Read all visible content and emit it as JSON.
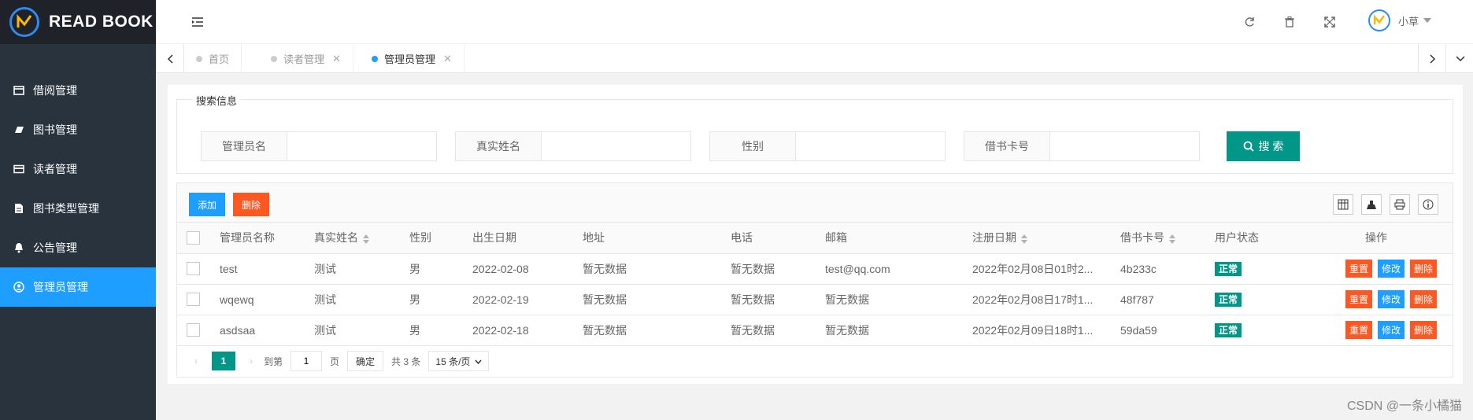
{
  "app": {
    "logo_text": "READ BOOK"
  },
  "sidebar": {
    "items": [
      {
        "label": "借阅管理",
        "icon": "window-icon"
      },
      {
        "label": "图书管理",
        "icon": "book-icon"
      },
      {
        "label": "读者管理",
        "icon": "card-icon"
      },
      {
        "label": "图书类型管理",
        "icon": "file-icon"
      },
      {
        "label": "公告管理",
        "icon": "bell-icon"
      },
      {
        "label": "管理员管理",
        "icon": "user-circle-icon",
        "active": true
      }
    ]
  },
  "header": {
    "user_name": "小草"
  },
  "tabs": [
    {
      "label": "首页"
    },
    {
      "label": "读者管理"
    },
    {
      "label": "管理员管理",
      "active": true
    }
  ],
  "search": {
    "legend": "搜索信息",
    "fields": [
      {
        "label": "管理员名",
        "value": ""
      },
      {
        "label": "真实姓名",
        "value": ""
      },
      {
        "label": "性别",
        "value": ""
      },
      {
        "label": "借书卡号",
        "value": ""
      }
    ],
    "button": "搜 索"
  },
  "toolbar": {
    "add": "添加",
    "delete": "删除"
  },
  "table": {
    "headers": [
      "管理员名称",
      "真实姓名",
      "性别",
      "出生日期",
      "地址",
      "电话",
      "邮箱",
      "注册日期",
      "借书卡号",
      "用户状态",
      "操作"
    ],
    "rows": [
      {
        "name": "test",
        "real": "测试",
        "sex": "男",
        "birth": "2022-02-08",
        "addr": "暂无数据",
        "phone": "暂无数据",
        "email": "test@qq.com",
        "reg": "2022年02月08日01时2...",
        "card": "4b233c",
        "status": "正常"
      },
      {
        "name": "wqewq",
        "real": "测试",
        "sex": "男",
        "birth": "2022-02-19",
        "addr": "暂无数据",
        "phone": "暂无数据",
        "email": "暂无数据",
        "reg": "2022年02月08日17时1...",
        "card": "48f787",
        "status": "正常"
      },
      {
        "name": "asdsaa",
        "real": "测试",
        "sex": "男",
        "birth": "2022-02-18",
        "addr": "暂无数据",
        "phone": "暂无数据",
        "email": "暂无数据",
        "reg": "2022年02月09日18时1...",
        "card": "59da59",
        "status": "正常"
      }
    ],
    "ops": {
      "reset": "重置",
      "edit": "修改",
      "delete": "删除"
    }
  },
  "pager": {
    "current": "1",
    "goto_label": "到第",
    "page_input": "1",
    "page_unit": "页",
    "confirm": "确定",
    "total": "共 3 条",
    "per_page": "15 条/页"
  },
  "watermark": "CSDN @一条小橘猫",
  "colors": {
    "sidebar": "#28333e",
    "active": "#1e9fff",
    "primary": "#009688",
    "danger": "#ff5722"
  }
}
